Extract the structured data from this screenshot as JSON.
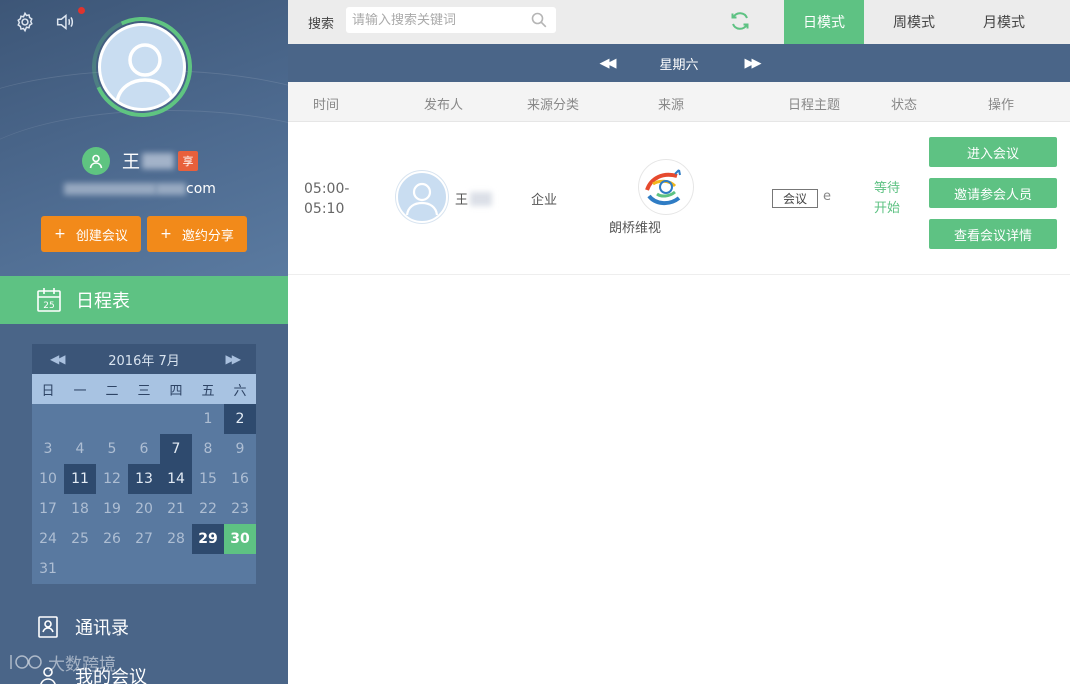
{
  "colors": {
    "accent_green": "#5ec283",
    "sidebar_blue": "#4a6588",
    "orange": "#f28a1a",
    "calendar_dark": "#2e4a6e"
  },
  "sidebar": {
    "icons": {
      "settings": "gear-icon",
      "sound": "speaker-icon"
    },
    "user": {
      "name": "王",
      "vip_badge": "享",
      "email_suffix": "com"
    },
    "buttons": {
      "create": {
        "plus": "+",
        "label": "创建会议"
      },
      "share": {
        "plus": "+",
        "label": "邀约分享"
      }
    },
    "schedule_menu": {
      "label": "日程表",
      "icon_day": "25"
    },
    "calendar": {
      "prev": "◀◀",
      "next": "▶▶",
      "month_label": "2016年 7月",
      "weekdays": [
        "日",
        "一",
        "二",
        "三",
        "四",
        "五",
        "六"
      ],
      "days": [
        {
          "d": "",
          "s": ""
        },
        {
          "d": "",
          "s": ""
        },
        {
          "d": "",
          "s": ""
        },
        {
          "d": "",
          "s": ""
        },
        {
          "d": "",
          "s": ""
        },
        {
          "d": "1",
          "s": ""
        },
        {
          "d": "2",
          "s": "dark"
        },
        {
          "d": "3",
          "s": ""
        },
        {
          "d": "4",
          "s": ""
        },
        {
          "d": "5",
          "s": ""
        },
        {
          "d": "6",
          "s": ""
        },
        {
          "d": "7",
          "s": "dark"
        },
        {
          "d": "8",
          "s": ""
        },
        {
          "d": "9",
          "s": ""
        },
        {
          "d": "10",
          "s": ""
        },
        {
          "d": "11",
          "s": "dark"
        },
        {
          "d": "12",
          "s": ""
        },
        {
          "d": "13",
          "s": "dark"
        },
        {
          "d": "14",
          "s": "dark"
        },
        {
          "d": "15",
          "s": ""
        },
        {
          "d": "16",
          "s": ""
        },
        {
          "d": "17",
          "s": ""
        },
        {
          "d": "18",
          "s": ""
        },
        {
          "d": "19",
          "s": ""
        },
        {
          "d": "20",
          "s": ""
        },
        {
          "d": "21",
          "s": ""
        },
        {
          "d": "22",
          "s": ""
        },
        {
          "d": "23",
          "s": ""
        },
        {
          "d": "24",
          "s": ""
        },
        {
          "d": "25",
          "s": ""
        },
        {
          "d": "26",
          "s": ""
        },
        {
          "d": "27",
          "s": ""
        },
        {
          "d": "28",
          "s": ""
        },
        {
          "d": "29",
          "s": "dark bold"
        },
        {
          "d": "30",
          "s": "today"
        },
        {
          "d": "31",
          "s": ""
        },
        {
          "d": "",
          "s": ""
        },
        {
          "d": "",
          "s": ""
        },
        {
          "d": "",
          "s": ""
        },
        {
          "d": "",
          "s": ""
        },
        {
          "d": "",
          "s": ""
        },
        {
          "d": "",
          "s": ""
        }
      ]
    },
    "menu": {
      "contacts": "通讯录",
      "meetings": "我的会议"
    },
    "watermark": "大数跨境"
  },
  "main": {
    "search": {
      "label": "搜索",
      "placeholder": "请输入搜索关键词"
    },
    "modes": {
      "day": "日模式",
      "week": "周模式",
      "month": "月模式"
    },
    "day_nav": {
      "prev": "◀◀",
      "label": "星期六",
      "next": "▶▶"
    },
    "columns": {
      "time": "时间",
      "publisher": "发布人",
      "source_category": "来源分类",
      "source": "来源",
      "topic": "日程主题",
      "status": "状态",
      "actions": "操作"
    },
    "row": {
      "time_start": "05:00-",
      "time_end": "05:10",
      "publisher": "王",
      "source_category": "企业",
      "source_name": "朗桥维视",
      "topic_tag": "会议",
      "topic_suffix": "e",
      "status": "等待开始",
      "actions": {
        "enter": "进入会议",
        "invite": "邀请参会人员",
        "detail": "查看会议详情"
      }
    }
  }
}
